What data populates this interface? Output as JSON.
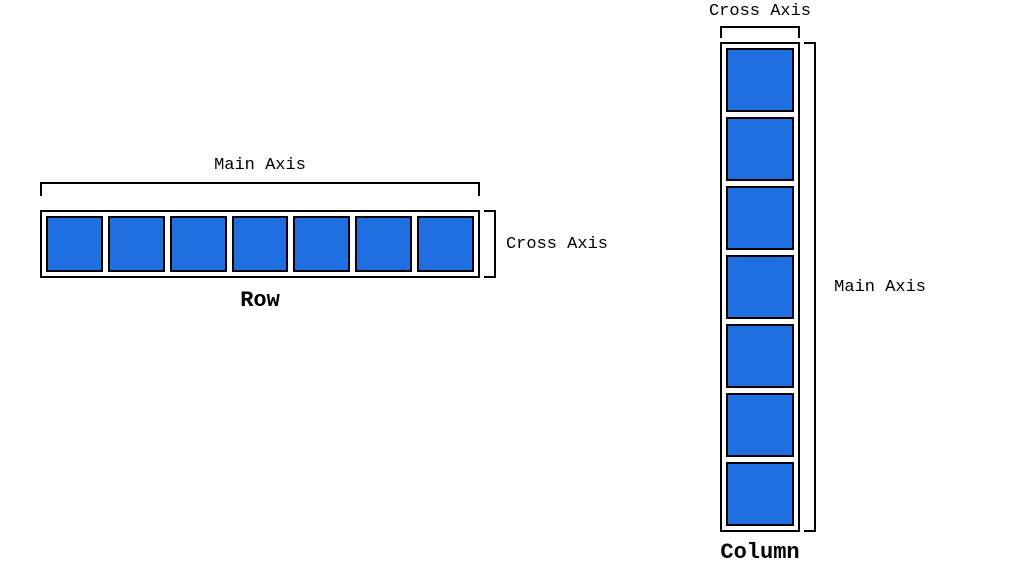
{
  "row": {
    "main_axis_label": "Main Axis",
    "cross_axis_label": "Cross Axis",
    "title": "Row",
    "item_count": 7,
    "item_color": "#1f6fe0"
  },
  "column": {
    "main_axis_label": "Main Axis",
    "cross_axis_label": "Cross Axis",
    "title": "Column",
    "item_count": 7,
    "item_color": "#1f6fe0"
  },
  "chart_data": {
    "type": "diagram",
    "description": "Illustration of flex row vs column main/cross axes",
    "row": {
      "direction": "row",
      "main_axis": "horizontal",
      "cross_axis": "vertical",
      "items": 7
    },
    "column": {
      "direction": "column",
      "main_axis": "vertical",
      "cross_axis": "horizontal",
      "items": 7
    }
  }
}
